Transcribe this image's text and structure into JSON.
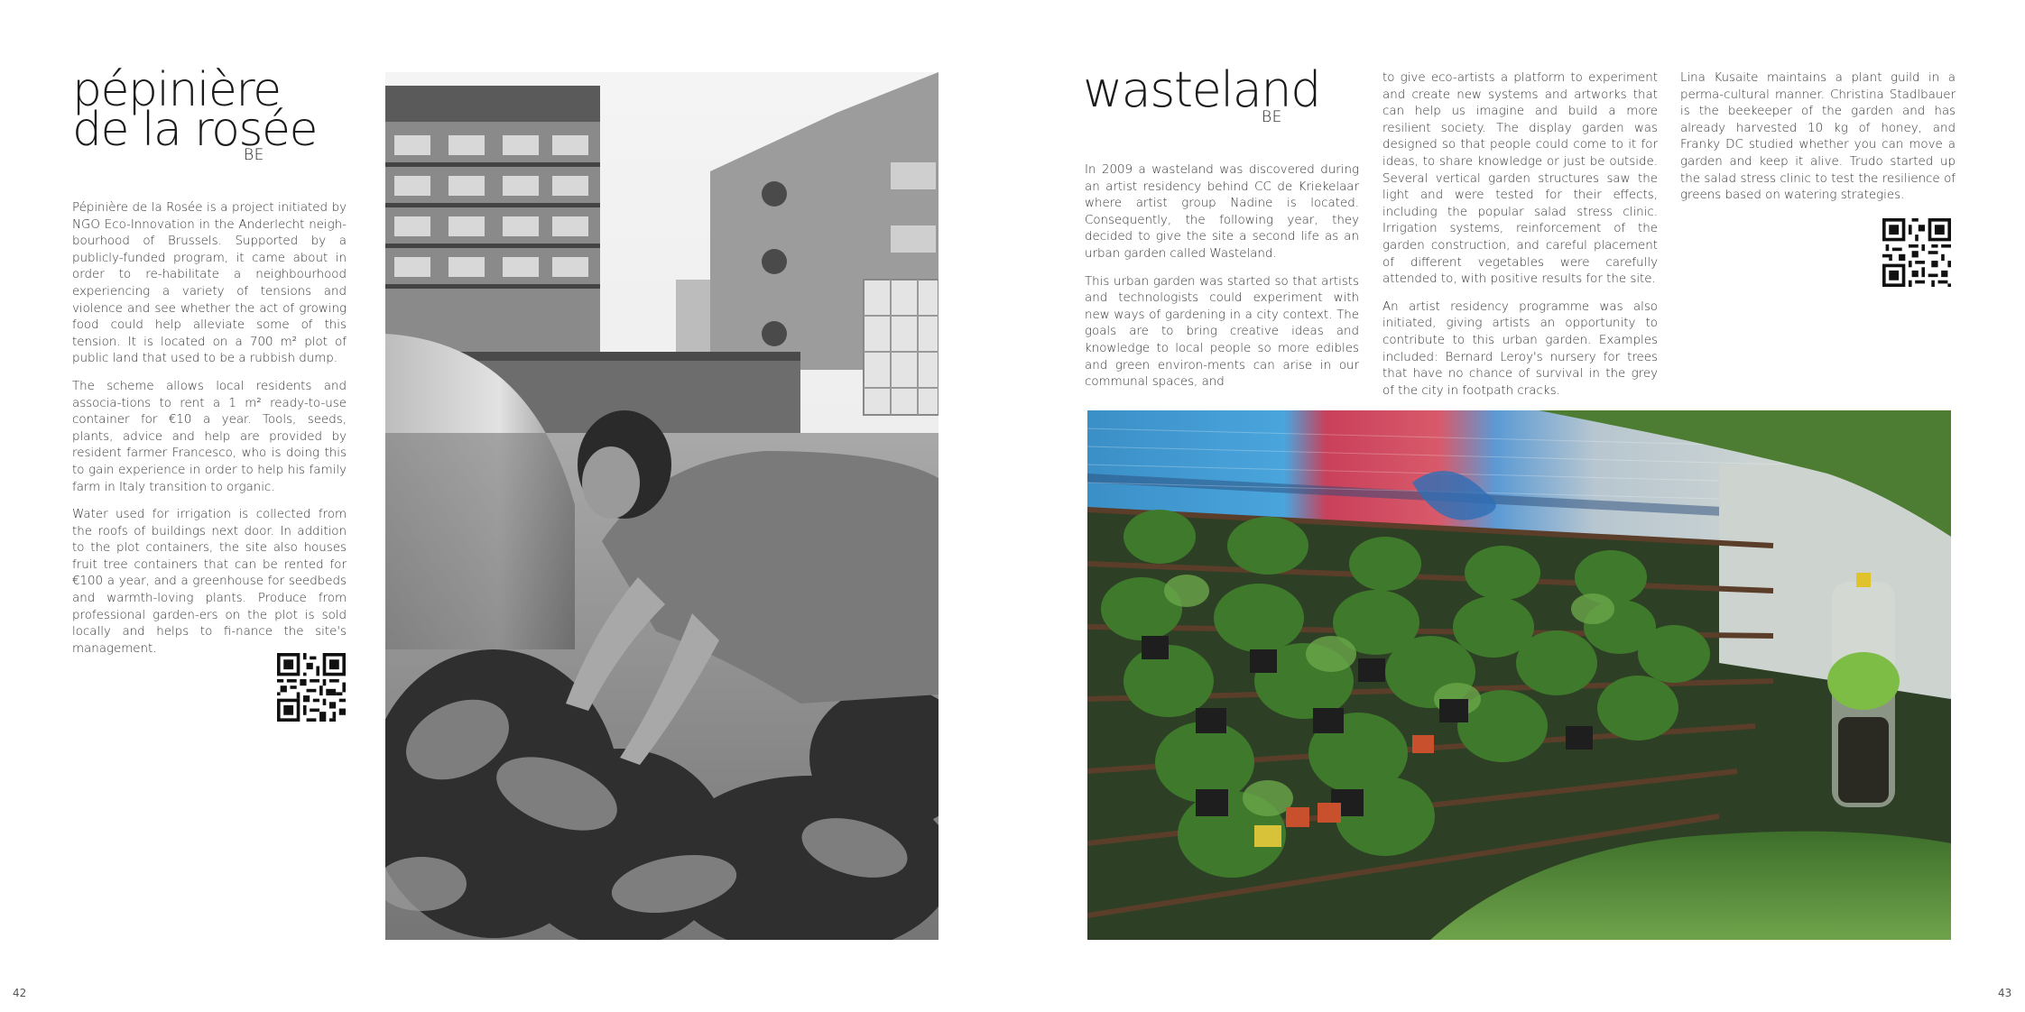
{
  "left_page": {
    "title_line1": "pépinière",
    "title_line2": "de la rosée",
    "country": "BE",
    "paragraphs": [
      "Pépinière de la Rosée is a project initiated by NGO Eco-Innovation in the Anderlecht neigh-bourhood of Brussels. Supported by a publicly-funded program, it came about in order to re-habilitate a neighbourhood experiencing a variety of tensions and violence and see whether the act of growing food could help alleviate some of this tension. It is located on a 700 m² plot of public land that used to be a rubbish dump.",
      "The scheme allows local residents and associa-tions to rent a 1 m² ready-to-use container for €10 a year. Tools, seeds, plants, advice and help are provided by resident farmer Francesco, who is doing this to gain experience in order to help his family farm in Italy transition to organic.",
      "Water used for irrigation is collected from the roofs of buildings next door. In addition to the plot containers, the site also houses fruit tree containers that can be rented for €100 a year, and a greenhouse for seedbeds and warmth-loving plants. Produce from professional garden-ers on the plot is sold locally and helps to fi-nance the site's management."
    ],
    "page_number": "42"
  },
  "right_page": {
    "title": "wasteland",
    "country": "BE",
    "column1": [
      "In 2009 a wasteland was discovered during an artist residency behind CC de Kriekelaar where artist group Nadine is located. Consequently, the following year, they decided to give the site a second life as an urban garden called Wasteland.",
      "This urban garden was started so that artists and technologists could experiment with new ways of gardening in a city context. The goals are to bring creative ideas and knowledge to local people so more edibles and green environ-ments can arise in our communal spaces, and"
    ],
    "column2": [
      "to give eco-artists a platform to experiment and create new systems and artworks that can help us imagine and build a more resilient society. The display garden was designed so that people could come to it for ideas, to share knowledge or just be outside. Several vertical garden structures saw the light and were tested for their effects, including the popular salad stress clinic. Irrigation systems, reinforcement of the garden construction, and careful placement of different vegetables were carefully attended to, with positive results for the site.",
      "An artist residency programme was also initiated, giving artists an opportunity to contribute to this urban garden. Examples included: Bernard Leroy's nursery for trees that have no chance of survival in the grey of the city in footpath cracks."
    ],
    "column3": [
      "Lina Kusaite maintains a plant guild in a perma-cultural manner. Christina Stadlbauer is the beekeeper of the garden and has already harvested 10 kg of honey, and Franky DC studied whether you can move a garden and keep it alive. Trudo started up the salad stress clinic to test the resilience of greens based on watering strategies."
    ],
    "page_number": "43"
  },
  "colors": {
    "text": "#333333",
    "title": "#1a1a1a",
    "photo_bw_dark": "#2b2b2b",
    "graffiti_blue": "#3aa0d8",
    "graffiti_red": "#d8485a",
    "foliage_green": "#3f6d2c"
  }
}
